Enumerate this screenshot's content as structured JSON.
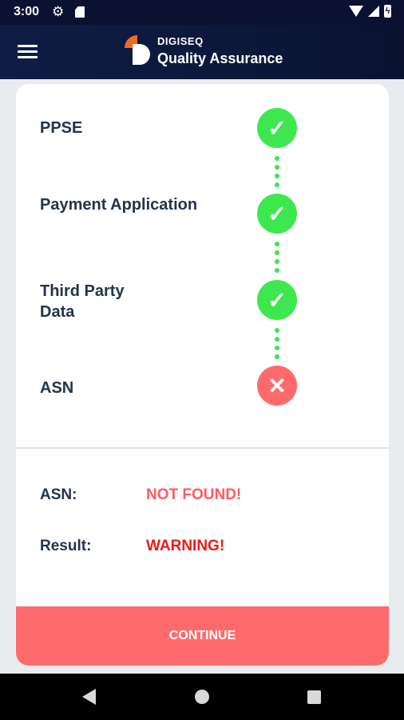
{
  "status_bar": {
    "time": "3:00"
  },
  "app_bar": {
    "brand_top": "DIGISEQ",
    "brand_main": "Quality Assurance"
  },
  "steps": [
    {
      "label": "PPSE",
      "status": "success"
    },
    {
      "label": "Payment Application",
      "status": "success"
    },
    {
      "label": "Third Party Data",
      "status": "success"
    },
    {
      "label": "ASN",
      "status": "failure"
    }
  ],
  "info": {
    "asn_label": "ASN:",
    "asn_value": "NOT FOUND!",
    "result_label": "Result:",
    "result_value": "WARNING!"
  },
  "continue_button": "CONTINUE",
  "colors": {
    "success": "#3de84f",
    "failure": "#ff6b6d",
    "warning_text": "#f01818",
    "not_found_text": "#ff5a5f",
    "header": "#0d1a3e"
  }
}
